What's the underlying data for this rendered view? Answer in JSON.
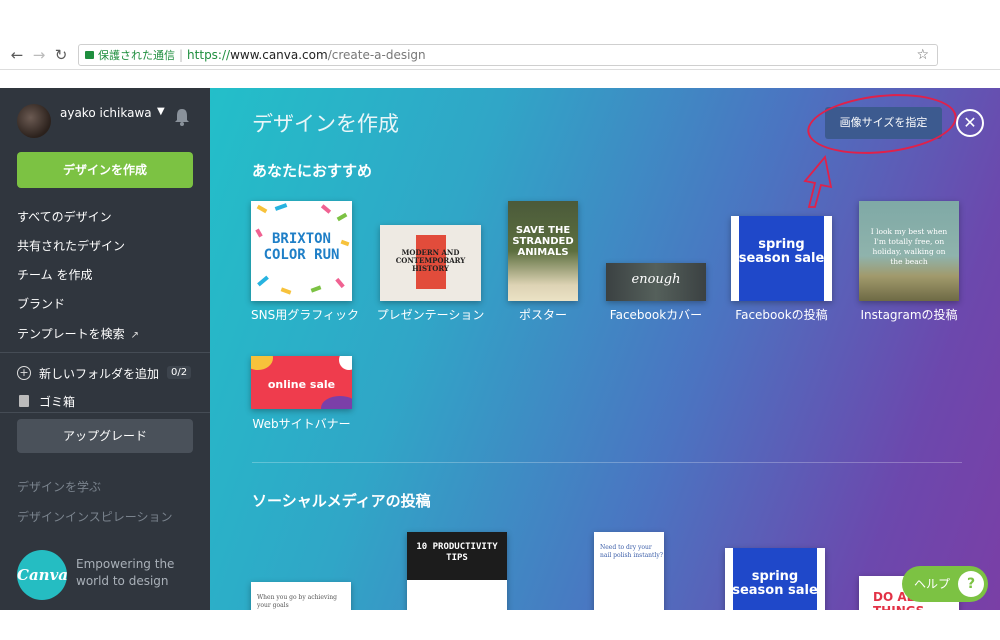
{
  "browser": {
    "secure_label": "保護された通信",
    "url_scheme": "https://",
    "url_host": "www.canva.com",
    "url_path": "/create-a-design",
    "back_glyph": "←",
    "forward_glyph": "→",
    "reload_glyph": "↻",
    "star_glyph": "☆"
  },
  "sidebar": {
    "username": "ayako ichikawa",
    "create_button": "デザインを作成",
    "nav": [
      {
        "label": "すべてのデザイン"
      },
      {
        "label": "共有されたデザイン"
      },
      {
        "label": "チーム を作成"
      },
      {
        "label": "ブランド"
      },
      {
        "label": "テンプレートを検索"
      }
    ],
    "add_folder": "新しいフォルダを追加",
    "folder_count": "0/2",
    "trash": "ゴミ箱",
    "upgrade": "アップグレード",
    "learn": "デザインを学ぶ",
    "inspiration": "デザインインスピレーション",
    "logo_text": "Canva",
    "tagline": "Empowering the world to design"
  },
  "main": {
    "title": "デザインを作成",
    "custom_size_button": "画像サイズを指定",
    "close_glyph": "✕",
    "recommended_title": "あなたにおすすめ",
    "social_title": "ソーシャルメディアの投稿",
    "recommended": [
      {
        "caption": "SNS用グラフィック",
        "thumb": "BRIXTON COLOR RUN"
      },
      {
        "caption": "プレゼンテーション",
        "thumb": "MODERN AND CONTEMPORARY HISTORY"
      },
      {
        "caption": "ポスター",
        "thumb": "SAVE THE STRANDED ANIMALS"
      },
      {
        "caption": "Facebookカバー",
        "thumb": "enough"
      },
      {
        "caption": "Facebookの投稿",
        "thumb": "spring season sale"
      },
      {
        "caption": "Instagramの投稿",
        "thumb": "I look my best when I'm totally free, on holiday, walking on the beach"
      },
      {
        "caption": "Webサイトバナー",
        "thumb": "online sale"
      }
    ],
    "social": [
      {
        "thumb": "When you go by achieving your goals"
      },
      {
        "thumb": "10 PRODUCTIVITY TIPS"
      },
      {
        "thumb": "Need to dry your nail polish instantly?"
      },
      {
        "thumb": "spring season sale"
      },
      {
        "thumb": "DO ALL THINGS"
      }
    ]
  },
  "help": {
    "label": "ヘルプ",
    "glyph": "?"
  },
  "colors": {
    "sidebar_bg": "#30363e",
    "accent_green": "#7cc243",
    "annotation_red": "#e0214a"
  }
}
